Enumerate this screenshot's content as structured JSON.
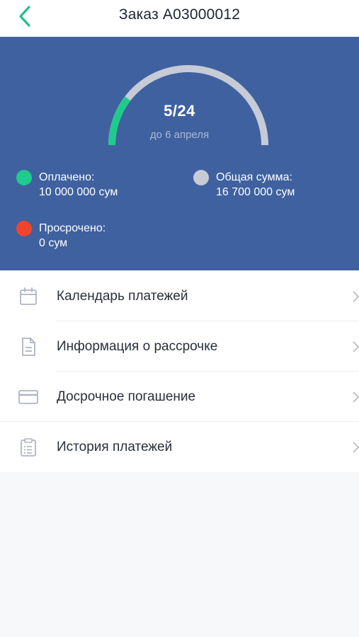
{
  "header": {
    "title": "Заказ A03000012",
    "back_icon": "chevron-left-icon"
  },
  "summary": {
    "progress": {
      "value_text": "5/24",
      "paid_count": 5,
      "total_count": 24,
      "caption": "до 6 апреля"
    },
    "paid": {
      "label": "Оплачено:",
      "value": "10 000 000 сум",
      "color": "#1fcb8b"
    },
    "total": {
      "label": "Общая сумма:",
      "value": "16 700 000 сум",
      "color": "#c6cbd6"
    },
    "overdue": {
      "label": "Просрочено:",
      "value": "0 сум",
      "color": "#f0452b"
    },
    "background_color": "#3f619f"
  },
  "menu": {
    "items": [
      {
        "label": "Календарь платежей",
        "icon": "calendar-icon"
      },
      {
        "label": "Информация о рассрочке",
        "icon": "document-icon"
      },
      {
        "label": "Досрочное погашение",
        "icon": "credit-card-icon"
      },
      {
        "label": "История платежей",
        "icon": "clipboard-icon"
      }
    ]
  }
}
